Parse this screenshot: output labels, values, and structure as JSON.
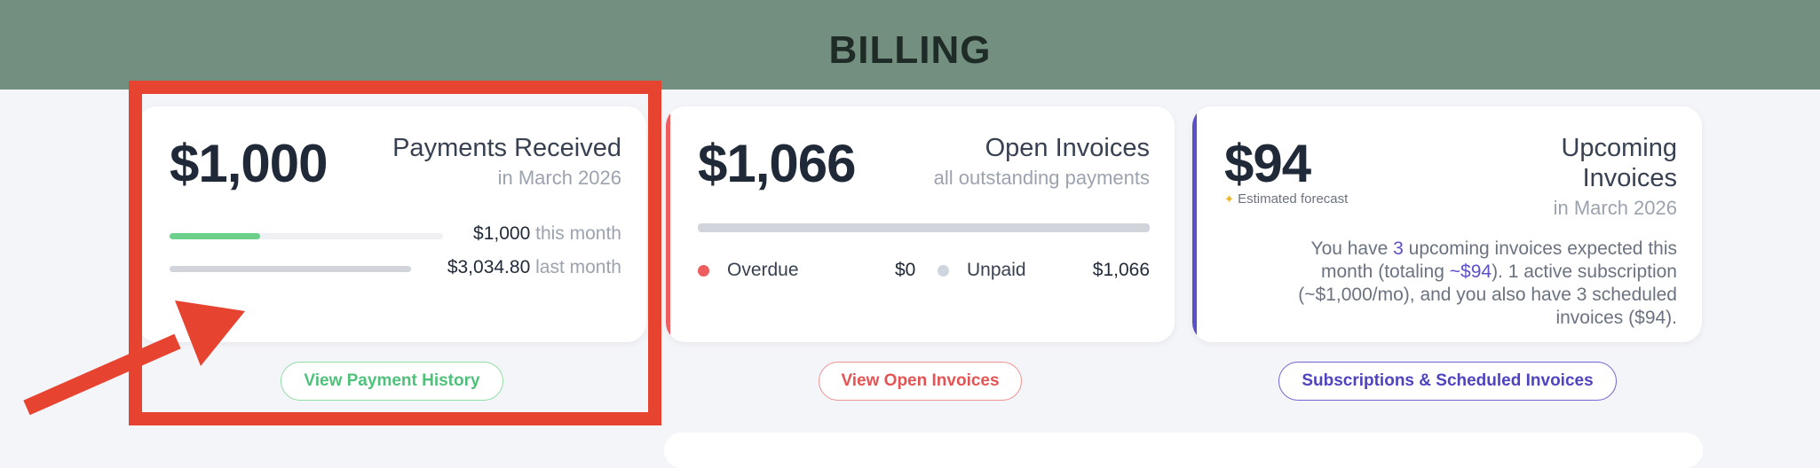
{
  "header": {
    "title": "BILLING"
  },
  "colors": {
    "header_bg": "#728f80",
    "green": "#6dd08a",
    "red": "#ef5e5e",
    "purple": "#5b50c8",
    "annotation": "#e64330"
  },
  "payments": {
    "amount": "$1,000",
    "title": "Payments Received",
    "subtitle": "in March 2026",
    "this_month_amount": "$1,000",
    "this_month_label": "this month",
    "last_month_amount": "$3,034.80",
    "last_month_label": "last month",
    "this_month_fill_fraction": 0.33,
    "button_label": "View Payment History"
  },
  "open_invoices": {
    "amount": "$1,066",
    "title": "Open Invoices",
    "subtitle": "all outstanding payments",
    "overdue_label": "Overdue",
    "overdue_value": "$0",
    "unpaid_label": "Unpaid",
    "unpaid_value": "$1,066",
    "button_label": "View Open Invoices"
  },
  "upcoming": {
    "amount": "$94",
    "estimate_icon": "sparkle-icon",
    "estimate_label": "Estimated forecast",
    "title_line1": "Upcoming",
    "title_line2": "Invoices",
    "subtitle": "in March 2026",
    "note_part1": "You have ",
    "note_count": "3",
    "note_part2": " upcoming invoices expected this month (totaling ",
    "note_total": "~$94",
    "note_part3": "). 1 active subscription (~$1,000/mo), and you also have 3 scheduled invoices ($94).",
    "button_label": "Subscriptions & Scheduled Invoices"
  }
}
